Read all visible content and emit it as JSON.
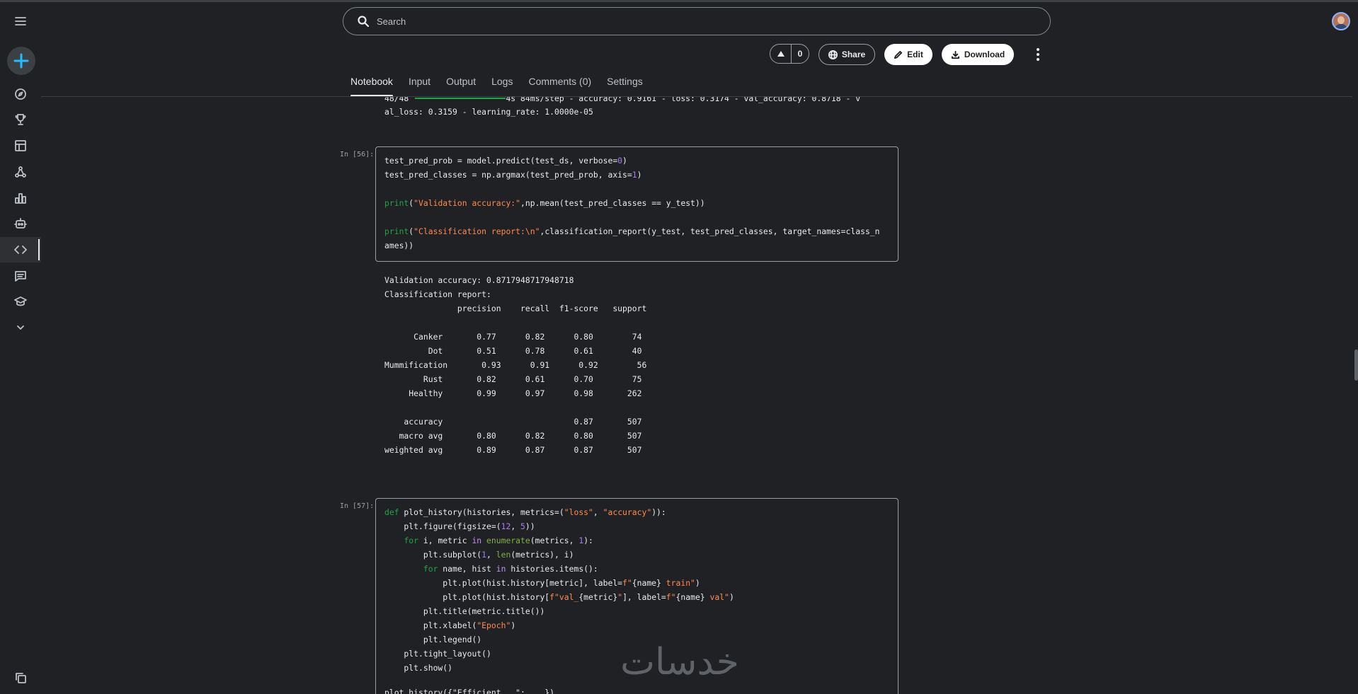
{
  "search": {
    "placeholder": "Search"
  },
  "sidebar": {
    "items": [
      {
        "icon": "menu-icon",
        "name": "menu-button"
      },
      {
        "icon": "plus-icon",
        "name": "create-button"
      },
      {
        "icon": "compass-icon",
        "name": "sidebar-item-explore"
      },
      {
        "icon": "trophy-icon",
        "name": "sidebar-item-competitions"
      },
      {
        "icon": "table-icon",
        "name": "sidebar-item-datasets"
      },
      {
        "icon": "models-icon",
        "name": "sidebar-item-models"
      },
      {
        "icon": "chart-icon",
        "name": "sidebar-item-benchmarks"
      },
      {
        "icon": "robot-icon",
        "name": "sidebar-item-games"
      },
      {
        "icon": "code-icon",
        "name": "sidebar-item-code"
      },
      {
        "icon": "comment-icon",
        "name": "sidebar-item-discussions"
      },
      {
        "icon": "school-icon",
        "name": "sidebar-item-learn"
      },
      {
        "icon": "chevron-down-icon",
        "name": "sidebar-item-more"
      },
      {
        "icon": "copy-icon",
        "name": "sidebar-item-your-work"
      }
    ]
  },
  "actions": {
    "vote_count": "0",
    "share_label": "Share",
    "edit_label": "Edit",
    "download_label": "Download"
  },
  "tabs": [
    {
      "label": "Notebook",
      "active": true
    },
    {
      "label": "Input",
      "active": false
    },
    {
      "label": "Output",
      "active": false
    },
    {
      "label": "Logs",
      "active": false
    },
    {
      "label": "Comments (0)",
      "active": false
    },
    {
      "label": "Settings",
      "active": false
    }
  ],
  "training_output": {
    "line1": "48/48                    4s 84ms/step - accuracy: 0.9161 - loss: 0.3174 - val_accuracy: 0.8718 - v",
    "line2": "al_loss: 0.3159 - learning_rate: 1.0000e-05"
  },
  "cell56": {
    "prompt": "In [56]:",
    "output": [
      "Validation accuracy: 0.8717948717948718",
      "Classification report:",
      "               precision    recall  f1-score   support",
      "",
      "      Canker       0.77      0.82      0.80        74",
      "         Dot       0.51      0.78      0.61        40",
      "Mummification       0.93      0.91      0.92        56",
      "        Rust       0.82      0.61      0.70        75",
      "     Healthy       0.99      0.97      0.98       262",
      "",
      "    accuracy                           0.87       507",
      "   macro avg       0.80      0.82      0.80       507",
      "weighted avg       0.89      0.87      0.87       507"
    ]
  },
  "cell57": {
    "prompt": "In [57]:",
    "last_line_partial": "plot_history({\"Efficient...\": ...})"
  },
  "watermark_text": "خدسات",
  "colors": {
    "background": "#202124",
    "accent_blue": "#20beff",
    "progress_green": "#1ea446",
    "string_orange": "#ff8a4c",
    "keyword_purple": "#c792ea",
    "number_purple": "#a57eeb"
  }
}
